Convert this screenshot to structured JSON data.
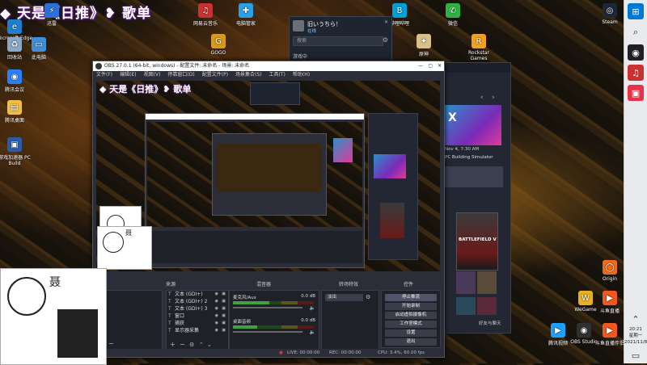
{
  "stream_title": "◆ 天是《日推》❥ 歌单",
  "desktop_icons_left": [
    {
      "label": "Microsoft Edge",
      "color": "#1e7fd0",
      "glyph": "e"
    },
    {
      "label": "回收站",
      "color": "#8aa9c8",
      "glyph": "♻"
    },
    {
      "label": "此电脑",
      "color": "#3f8fd8",
      "glyph": "▭"
    },
    {
      "label": "腾讯会议",
      "color": "#2a7fff",
      "glyph": "◉"
    },
    {
      "label": "腾讯桌面",
      "color": "#f0c040",
      "glyph": "▤"
    },
    {
      "label": "游戏加速器 PC Build",
      "color": "#2a5caa",
      "glyph": "▣"
    }
  ],
  "desktop_icons_top": [
    {
      "label": "迅雷",
      "color": "#2b6fd8",
      "glyph": "⚡"
    },
    {
      "label": "网易云音乐",
      "color": "#c83232",
      "glyph": "♫"
    },
    {
      "label": "电脑管家",
      "color": "#2aa0e8",
      "glyph": "✚"
    },
    {
      "label": "GOGO",
      "color": "#d89a1a",
      "glyph": "G"
    },
    {
      "label": "Rockstar Games",
      "color": "#f0a020",
      "glyph": "R"
    },
    {
      "label": "微信",
      "color": "#2bb43e",
      "glyph": "✆"
    },
    {
      "label": "原神",
      "color": "#d8c08a",
      "glyph": "✦"
    },
    {
      "label": "Steam",
      "color": "#1b2838",
      "glyph": "◎"
    },
    {
      "label": "哔哩哔哩",
      "color": "#00a1d6",
      "glyph": "B"
    }
  ],
  "desktop_icons_right": [
    {
      "label": "Origin",
      "color": "#f06a1a",
      "glyph": "◯"
    },
    {
      "label": "WeGame",
      "color": "#e8b020",
      "glyph": "W"
    },
    {
      "label": "斗鱼直播",
      "color": "#f0581e",
      "glyph": "▶"
    },
    {
      "label": "腾讯视频",
      "color": "#1ea0ff",
      "glyph": "▶"
    },
    {
      "label": "OBS Studio",
      "color": "#303030",
      "glyph": "◉"
    },
    {
      "label": "斗鱼直播伴侣",
      "color": "#f0581e",
      "glyph": "▶"
    }
  ],
  "obs": {
    "window_title": "OBS 27.0.1 (64-bit, windows) - 配置文件: 未命名 - 场景: 未命名",
    "menu": [
      "文件(F)",
      "编辑(E)",
      "视图(V)",
      "停靠窗口(D)",
      "配置文件(P)",
      "场景集合(S)",
      "工具(T)",
      "帮助(H)"
    ],
    "docks": {
      "scenes": "场景",
      "sources": "来源",
      "mixer": "混音器",
      "transitions": "转场特效",
      "controls": "控件"
    },
    "sources": [
      "文本 (GDI+)",
      "文本 (GDI+) 2",
      "文本 (GDI+) 3",
      "窗口",
      "捕获",
      "显示器采集"
    ],
    "mixer": [
      {
        "name": "麦克风/Aux",
        "db": "0.0 dB",
        "level": 0.45
      },
      {
        "name": "桌面音频",
        "db": "0.0 dB",
        "level": 0.3
      }
    ],
    "transition": {
      "value": "淡出",
      "duration": "300 ms"
    },
    "controls": [
      "停止推流",
      "开始录制",
      "启动虚拟摄像机",
      "工作室模式",
      "设置",
      "退出"
    ],
    "status": {
      "live": "LIVE: 00:00:00",
      "rec": "REC: 00:00:00",
      "cpu": "CPU: 3.4%, 60.00 fps"
    }
  },
  "friends_popup": {
    "username": "旧いうちら！",
    "status": "在线",
    "search_placeholder": "搜索",
    "section": "游戏中"
  },
  "store_panel": {
    "banner_text": "X",
    "news_line": "Nov 4, 7:30 AM",
    "game_title": "PC Building Simulator",
    "featured": "BATTLEFIELD V",
    "footer": "好友与聊天"
  },
  "webcam_caption": "聂",
  "clock": {
    "time": "20:21",
    "weekday": "星期一",
    "date": "2021/11/8"
  },
  "colors": {
    "accent": "#7a2ab8",
    "obs_bg": "#2b2e38",
    "live_red": "#c43b3b"
  }
}
